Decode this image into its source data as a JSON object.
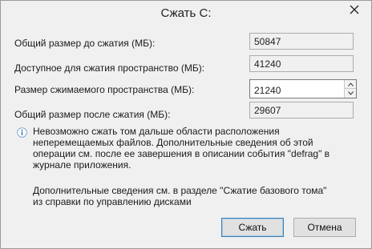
{
  "window": {
    "title": "Сжать C:"
  },
  "fields": [
    {
      "label": "Общий размер до сжатия (МБ):",
      "value": "50847"
    },
    {
      "label": "Доступное для сжатия пространство (МБ):",
      "value": "41240"
    },
    {
      "label": "Размер сжимаемого пространства (МБ):",
      "value": "21240"
    },
    {
      "label": "Общий размер после сжатия (МБ):",
      "value": "29607"
    }
  ],
  "note": "Невозможно сжать том дальше области расположения неперемещаемых файлов. Дополнительные сведения об этой операции см. после ее завершения в описании события \"defrag\" в журнале приложения.",
  "help_text": "Дополнительные сведения см. в разделе \"Сжатие базового тома\" из справки по управлению дисками",
  "buttons": {
    "shrink": "Сжать",
    "cancel": "Отмена"
  },
  "icons": {
    "close": "close-icon",
    "info": "info-icon",
    "up": "chevron-up-icon",
    "down": "chevron-down-icon"
  },
  "colors": {
    "dialog_bg": "#f0f0f0",
    "accent": "#3c7fb1",
    "info": "#2b6cb0"
  }
}
